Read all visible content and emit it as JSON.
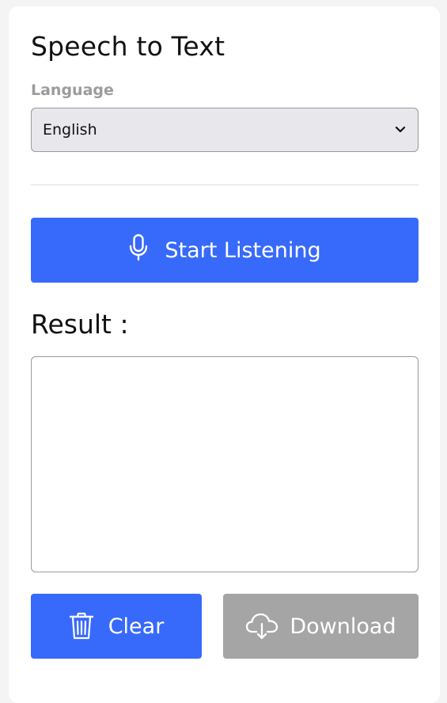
{
  "header": {
    "title": "Speech to Text"
  },
  "language": {
    "label": "Language",
    "selected": "English",
    "chevron_icon": "chevron-down-icon"
  },
  "actions": {
    "start_label": "Start Listening",
    "start_icon": "microphone-icon"
  },
  "result": {
    "label": "Result :",
    "text": "",
    "placeholder": ""
  },
  "footer": {
    "clear_label": "Clear",
    "clear_icon": "trash-icon",
    "download_label": "Download",
    "download_icon": "cloud-download-icon"
  },
  "colors": {
    "primary": "#3769fb",
    "disabled": "#a5a5a5",
    "muted_label": "#9b9b9b"
  }
}
